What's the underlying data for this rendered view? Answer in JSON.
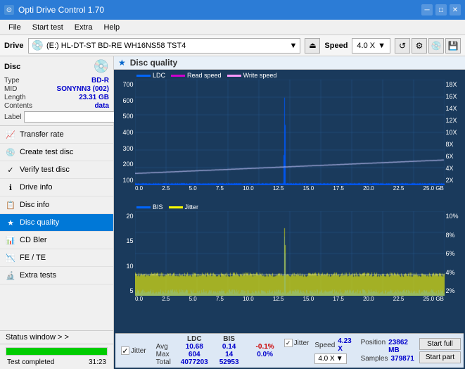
{
  "titlebar": {
    "title": "Opti Drive Control 1.70",
    "icon": "⊙",
    "minimize": "─",
    "maximize": "□",
    "close": "✕"
  },
  "menubar": {
    "items": [
      "File",
      "Start test",
      "Extra",
      "Help"
    ]
  },
  "drivebar": {
    "label": "Drive",
    "drive_value": "(E:)  HL-DT-ST BD-RE  WH16NS58 TST4",
    "speed_label": "Speed",
    "speed_value": "4.0 X"
  },
  "disc": {
    "title": "Disc",
    "type_label": "Type",
    "type_value": "BD-R",
    "mid_label": "MID",
    "mid_value": "SONYNN3 (002)",
    "length_label": "Length",
    "length_value": "23.31 GB",
    "contents_label": "Contents",
    "contents_value": "data",
    "label_label": "Label"
  },
  "nav": {
    "items": [
      {
        "id": "transfer-rate",
        "label": "Transfer rate",
        "icon": "📈"
      },
      {
        "id": "create-test-disc",
        "label": "Create test disc",
        "icon": "💿"
      },
      {
        "id": "verify-test-disc",
        "label": "Verify test disc",
        "icon": "✓"
      },
      {
        "id": "drive-info",
        "label": "Drive info",
        "icon": "ℹ"
      },
      {
        "id": "disc-info",
        "label": "Disc info",
        "icon": "📋"
      },
      {
        "id": "disc-quality",
        "label": "Disc quality",
        "icon": "★",
        "active": true
      },
      {
        "id": "cd-bler",
        "label": "CD Bler",
        "icon": "📊"
      },
      {
        "id": "fe-te",
        "label": "FE / TE",
        "icon": "📉"
      },
      {
        "id": "extra-tests",
        "label": "Extra tests",
        "icon": "🔬"
      }
    ]
  },
  "status_window": {
    "label": "Status window > >"
  },
  "progress": {
    "value": 100,
    "status": "Test completed",
    "time": "31:23"
  },
  "content": {
    "title": "Disc quality",
    "icon": "★"
  },
  "legend_top": {
    "ldc": {
      "label": "LDC",
      "color": "#0066ff"
    },
    "read_speed": {
      "label": "Read speed",
      "color": "#cc00cc"
    },
    "write_speed": {
      "label": "Write speed",
      "color": "#ffccff"
    }
  },
  "legend_bottom": {
    "bis": {
      "label": "BIS",
      "color": "#0066ff"
    },
    "jitter": {
      "label": "Jitter",
      "color": "#ffff00"
    }
  },
  "chart_top": {
    "y_labels_left": [
      "700",
      "600",
      "500",
      "400",
      "300",
      "200",
      "100",
      "0.0"
    ],
    "y_labels_right": [
      "18X",
      "16X",
      "14X",
      "12X",
      "10X",
      "8X",
      "6X",
      "4X",
      "2X"
    ],
    "x_labels": [
      "0.0",
      "2.5",
      "5.0",
      "7.5",
      "10.0",
      "12.5",
      "15.0",
      "17.5",
      "20.0",
      "22.5",
      "25.0 GB"
    ]
  },
  "chart_bottom": {
    "y_labels_left": [
      "20",
      "15",
      "10",
      "5",
      "0"
    ],
    "y_labels_right": [
      "10%",
      "8%",
      "6%",
      "4%",
      "2%"
    ],
    "x_labels": [
      "0.0",
      "2.5",
      "5.0",
      "7.5",
      "10.0",
      "12.5",
      "15.0",
      "17.5",
      "20.0",
      "22.5",
      "25.0 GB"
    ]
  },
  "stats": {
    "col_headers": [
      "LDC",
      "BIS",
      "",
      "Jitter",
      "Speed",
      ""
    ],
    "avg_label": "Avg",
    "avg_ldc": "10.68",
    "avg_bis": "0.14",
    "avg_jitter": "-0.1%",
    "max_label": "Max",
    "max_ldc": "604",
    "max_bis": "14",
    "max_jitter": "0.0%",
    "total_label": "Total",
    "total_ldc": "4077203",
    "total_bis": "52953",
    "speed_value": "4.23 X",
    "speed_select": "4.0 X",
    "position_label": "Position",
    "position_value": "23862 MB",
    "samples_label": "Samples",
    "samples_value": "379871",
    "jitter_checked": true,
    "start_full": "Start full",
    "start_part": "Start part"
  }
}
